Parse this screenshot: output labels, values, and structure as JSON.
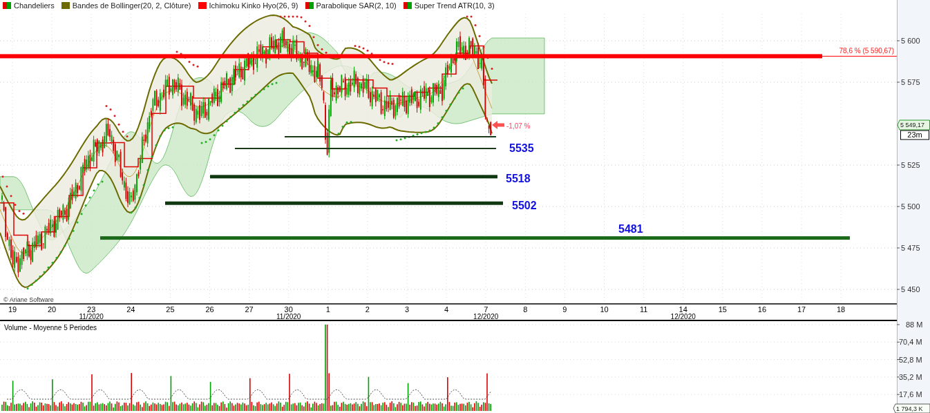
{
  "legend": [
    {
      "label": "Chandeliers",
      "swatch": [
        {
          "color": "#e00000"
        },
        {
          "color": "#00a000"
        }
      ]
    },
    {
      "label": "Bandes de Bollinger(20, 2, Clôture)",
      "swatch": [
        {
          "color": "#6b6b00"
        }
      ]
    },
    {
      "label": "Ichimoku Kinko Hyo(26, 9)",
      "swatch": [
        {
          "color": "#ff0000"
        }
      ]
    },
    {
      "label": "Parabolique SAR(2, 10)",
      "swatch": [
        {
          "color": "#e00000"
        },
        {
          "color": "#00a000"
        }
      ]
    },
    {
      "label": "Super Trend ATR(10, 3)",
      "swatch": [
        {
          "color": "#e00000"
        },
        {
          "color": "#00a000"
        }
      ]
    }
  ],
  "price_axis": {
    "ticks": [
      "5 600",
      "5 575",
      "5 525",
      "5 500",
      "5 475",
      "5 450"
    ],
    "last_price": "5 549,17",
    "timeframe": "23m"
  },
  "fibonacci_line": {
    "label": "78,6 % (5 590,67)"
  },
  "change_label": "-1,07 %",
  "levels": [
    {
      "label": "5535"
    },
    {
      "label": "5518"
    },
    {
      "label": "5502"
    },
    {
      "label": "5481"
    }
  ],
  "copyright": "© Ariane Software",
  "date_axis": [
    {
      "day": "19"
    },
    {
      "day": "20"
    },
    {
      "day": "23",
      "month": "11/2020"
    },
    {
      "day": "24"
    },
    {
      "day": "25"
    },
    {
      "day": "26"
    },
    {
      "day": "27"
    },
    {
      "day": "30",
      "month": "11/2020"
    },
    {
      "day": "1"
    },
    {
      "day": "2"
    },
    {
      "day": "3"
    },
    {
      "day": "4"
    },
    {
      "day": "7",
      "month": "12/2020"
    },
    {
      "day": "8"
    },
    {
      "day": "9"
    },
    {
      "day": "10"
    },
    {
      "day": "11"
    },
    {
      "day": "14",
      "month": "12/2020"
    },
    {
      "day": "15"
    },
    {
      "day": "16"
    },
    {
      "day": "17"
    },
    {
      "day": "18"
    }
  ],
  "volume": {
    "title": "Volume  - Moyenne 5 Periodes",
    "ticks": [
      "88 M",
      "70,4 M",
      "52,8 M",
      "35,2 M",
      "17,6 M"
    ],
    "last": "1 794,3 K"
  }
}
